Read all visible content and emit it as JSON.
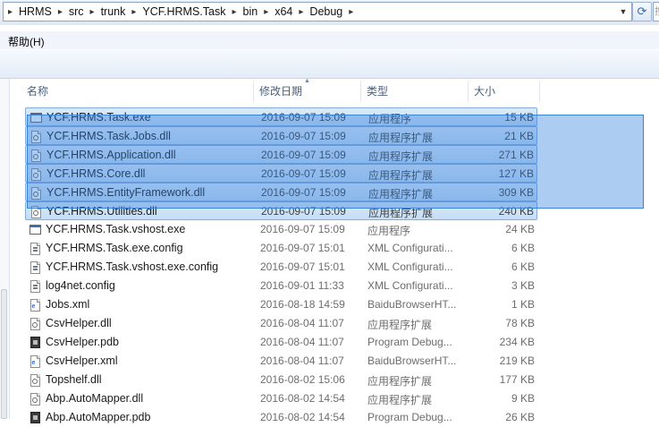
{
  "address": {
    "segments": [
      "HRMS",
      "src",
      "trunk",
      "YCF.HRMS.Task",
      "bin",
      "x64",
      "Debug"
    ],
    "search_fragment": "搜"
  },
  "menu": {
    "help_label": "帮助(H)"
  },
  "columns": {
    "name": "名称",
    "date": "修改日期",
    "type": "类型",
    "size": "大小"
  },
  "files": [
    {
      "name": "YCF.HRMS.Task.exe",
      "date": "2016-09-07 15:09",
      "type": "应用程序",
      "size": "15 KB",
      "icon": "exe-icon",
      "selected": true
    },
    {
      "name": "YCF.HRMS.Task.Jobs.dll",
      "date": "2016-09-07 15:09",
      "type": "应用程序扩展",
      "size": "21 KB",
      "icon": "dll-icon",
      "selected": true
    },
    {
      "name": "YCF.HRMS.Application.dll",
      "date": "2016-09-07 15:09",
      "type": "应用程序扩展",
      "size": "271 KB",
      "icon": "dll-icon",
      "selected": true
    },
    {
      "name": "YCF.HRMS.Core.dll",
      "date": "2016-09-07 15:09",
      "type": "应用程序扩展",
      "size": "127 KB",
      "icon": "dll-icon",
      "selected": true
    },
    {
      "name": "YCF.HRMS.EntityFramework.dll",
      "date": "2016-09-07 15:09",
      "type": "应用程序扩展",
      "size": "309 KB",
      "icon": "dll-icon",
      "selected": true
    },
    {
      "name": "YCF.HRMS.Utilities.dll",
      "date": "2016-09-07 15:09",
      "type": "应用程序扩展",
      "size": "240 KB",
      "icon": "dll-icon",
      "selected": true
    },
    {
      "name": "YCF.HRMS.Task.vshost.exe",
      "date": "2016-09-07 15:09",
      "type": "应用程序",
      "size": "24 KB",
      "icon": "exe-icon",
      "selected": false
    },
    {
      "name": "YCF.HRMS.Task.exe.config",
      "date": "2016-09-07 15:01",
      "type": "XML Configurati...",
      "size": "6 KB",
      "icon": "config-icon",
      "selected": false
    },
    {
      "name": "YCF.HRMS.Task.vshost.exe.config",
      "date": "2016-09-07 15:01",
      "type": "XML Configurati...",
      "size": "6 KB",
      "icon": "config-icon",
      "selected": false
    },
    {
      "name": "log4net.config",
      "date": "2016-09-01 11:33",
      "type": "XML Configurati...",
      "size": "3 KB",
      "icon": "config-icon",
      "selected": false
    },
    {
      "name": "Jobs.xml",
      "date": "2016-08-18 14:59",
      "type": "BaiduBrowserHT...",
      "size": "1 KB",
      "icon": "xml-icon",
      "selected": false
    },
    {
      "name": "CsvHelper.dll",
      "date": "2016-08-04 11:07",
      "type": "应用程序扩展",
      "size": "78 KB",
      "icon": "dll-icon",
      "selected": false
    },
    {
      "name": "CsvHelper.pdb",
      "date": "2016-08-04 11:07",
      "type": "Program Debug...",
      "size": "234 KB",
      "icon": "pdb-icon",
      "selected": false
    },
    {
      "name": "CsvHelper.xml",
      "date": "2016-08-04 11:07",
      "type": "BaiduBrowserHT...",
      "size": "219 KB",
      "icon": "xml-icon",
      "selected": false
    },
    {
      "name": "Topshelf.dll",
      "date": "2016-08-02 15:06",
      "type": "应用程序扩展",
      "size": "177 KB",
      "icon": "dll-icon",
      "selected": false
    },
    {
      "name": "Abp.AutoMapper.dll",
      "date": "2016-08-02 14:54",
      "type": "应用程序扩展",
      "size": "9 KB",
      "icon": "dll-icon",
      "selected": false
    },
    {
      "name": "Abp.AutoMapper.pdb",
      "date": "2016-08-02 14:54",
      "type": "Program Debug...",
      "size": "26 KB",
      "icon": "pdb-icon",
      "selected": false
    }
  ]
}
